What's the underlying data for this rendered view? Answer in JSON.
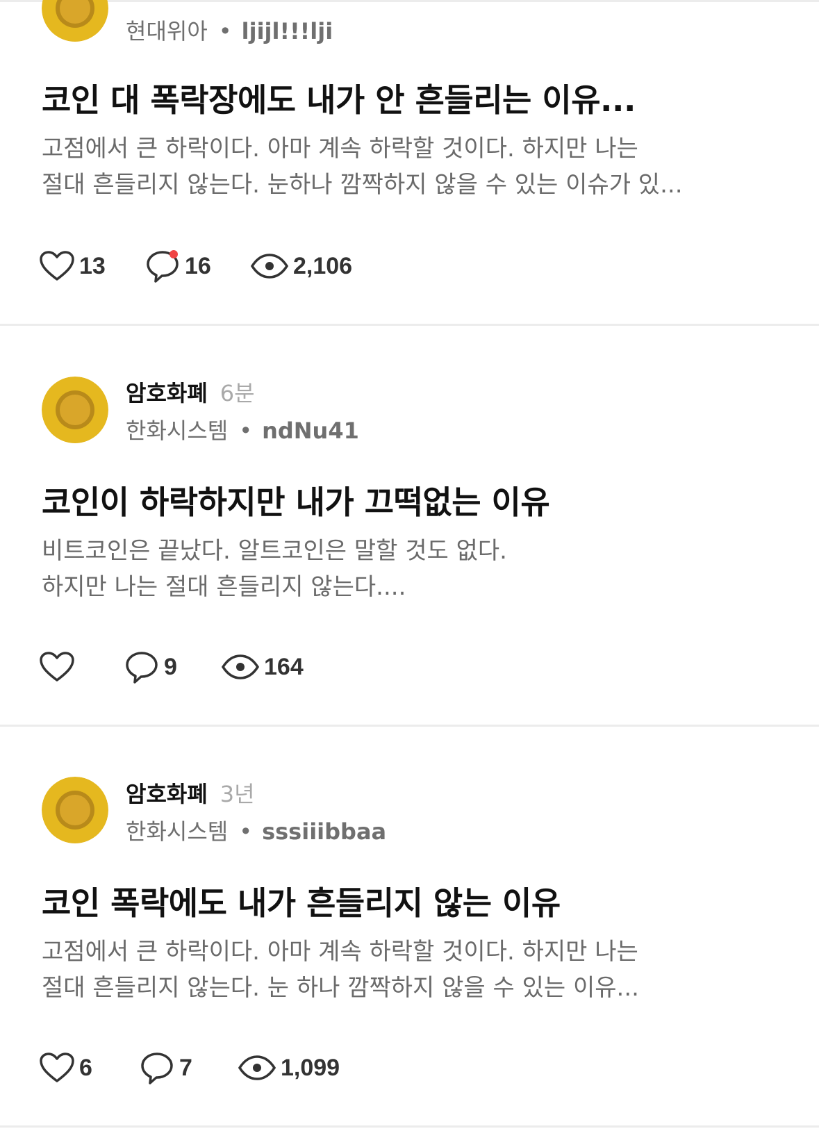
{
  "colors": {
    "avatar_gold": "#e5b81f",
    "notification_red": "#f04444",
    "divider": "#ececec"
  },
  "posts": [
    {
      "community": "",
      "time": "",
      "company": "현대위아",
      "handle": "ljijl!!!lji",
      "title": "코인 대 폭락장에도 내가 안 흔들리는 이유...",
      "excerpt": "고점에서 큰 하락이다. 아마 계속 하락할 것이다. 하지만 나는\n절대 흔들리지 않는다. 눈하나 깜짝하지 않을 수 있는 이슈가 있...",
      "likes": "13",
      "comments": "16",
      "views": "2,106",
      "has_notification": true
    },
    {
      "community": "암호화폐",
      "time": "6분",
      "company": "한화시스템",
      "handle": "ndNu41",
      "title": "코인이 하락하지만 내가 끄떡없는 이유",
      "excerpt": "비트코인은 끝났다. 알트코인은 말할 것도 없다.\n 하지만 나는 절대 흔들리지 않는다....",
      "likes": "",
      "comments": "9",
      "views": "164",
      "has_notification": false
    },
    {
      "community": "암호화폐",
      "time": "3년",
      "company": "한화시스템",
      "handle": "sssiiibbaa",
      "title": "코인 폭락에도 내가 흔들리지 않는 이유",
      "excerpt": "고점에서 큰 하락이다.  아마 계속 하락할 것이다.  하지만 나는\n절대 흔들리지 않는다.  눈 하나 깜짝하지 않을 수 있는 이유...",
      "likes": "6",
      "comments": "7",
      "views": "1,099",
      "has_notification": false
    }
  ],
  "icons": {
    "avatar": "bitcoin-coin-icon",
    "like": "heart-icon",
    "comment": "speech-bubble-icon",
    "view": "eye-icon"
  }
}
